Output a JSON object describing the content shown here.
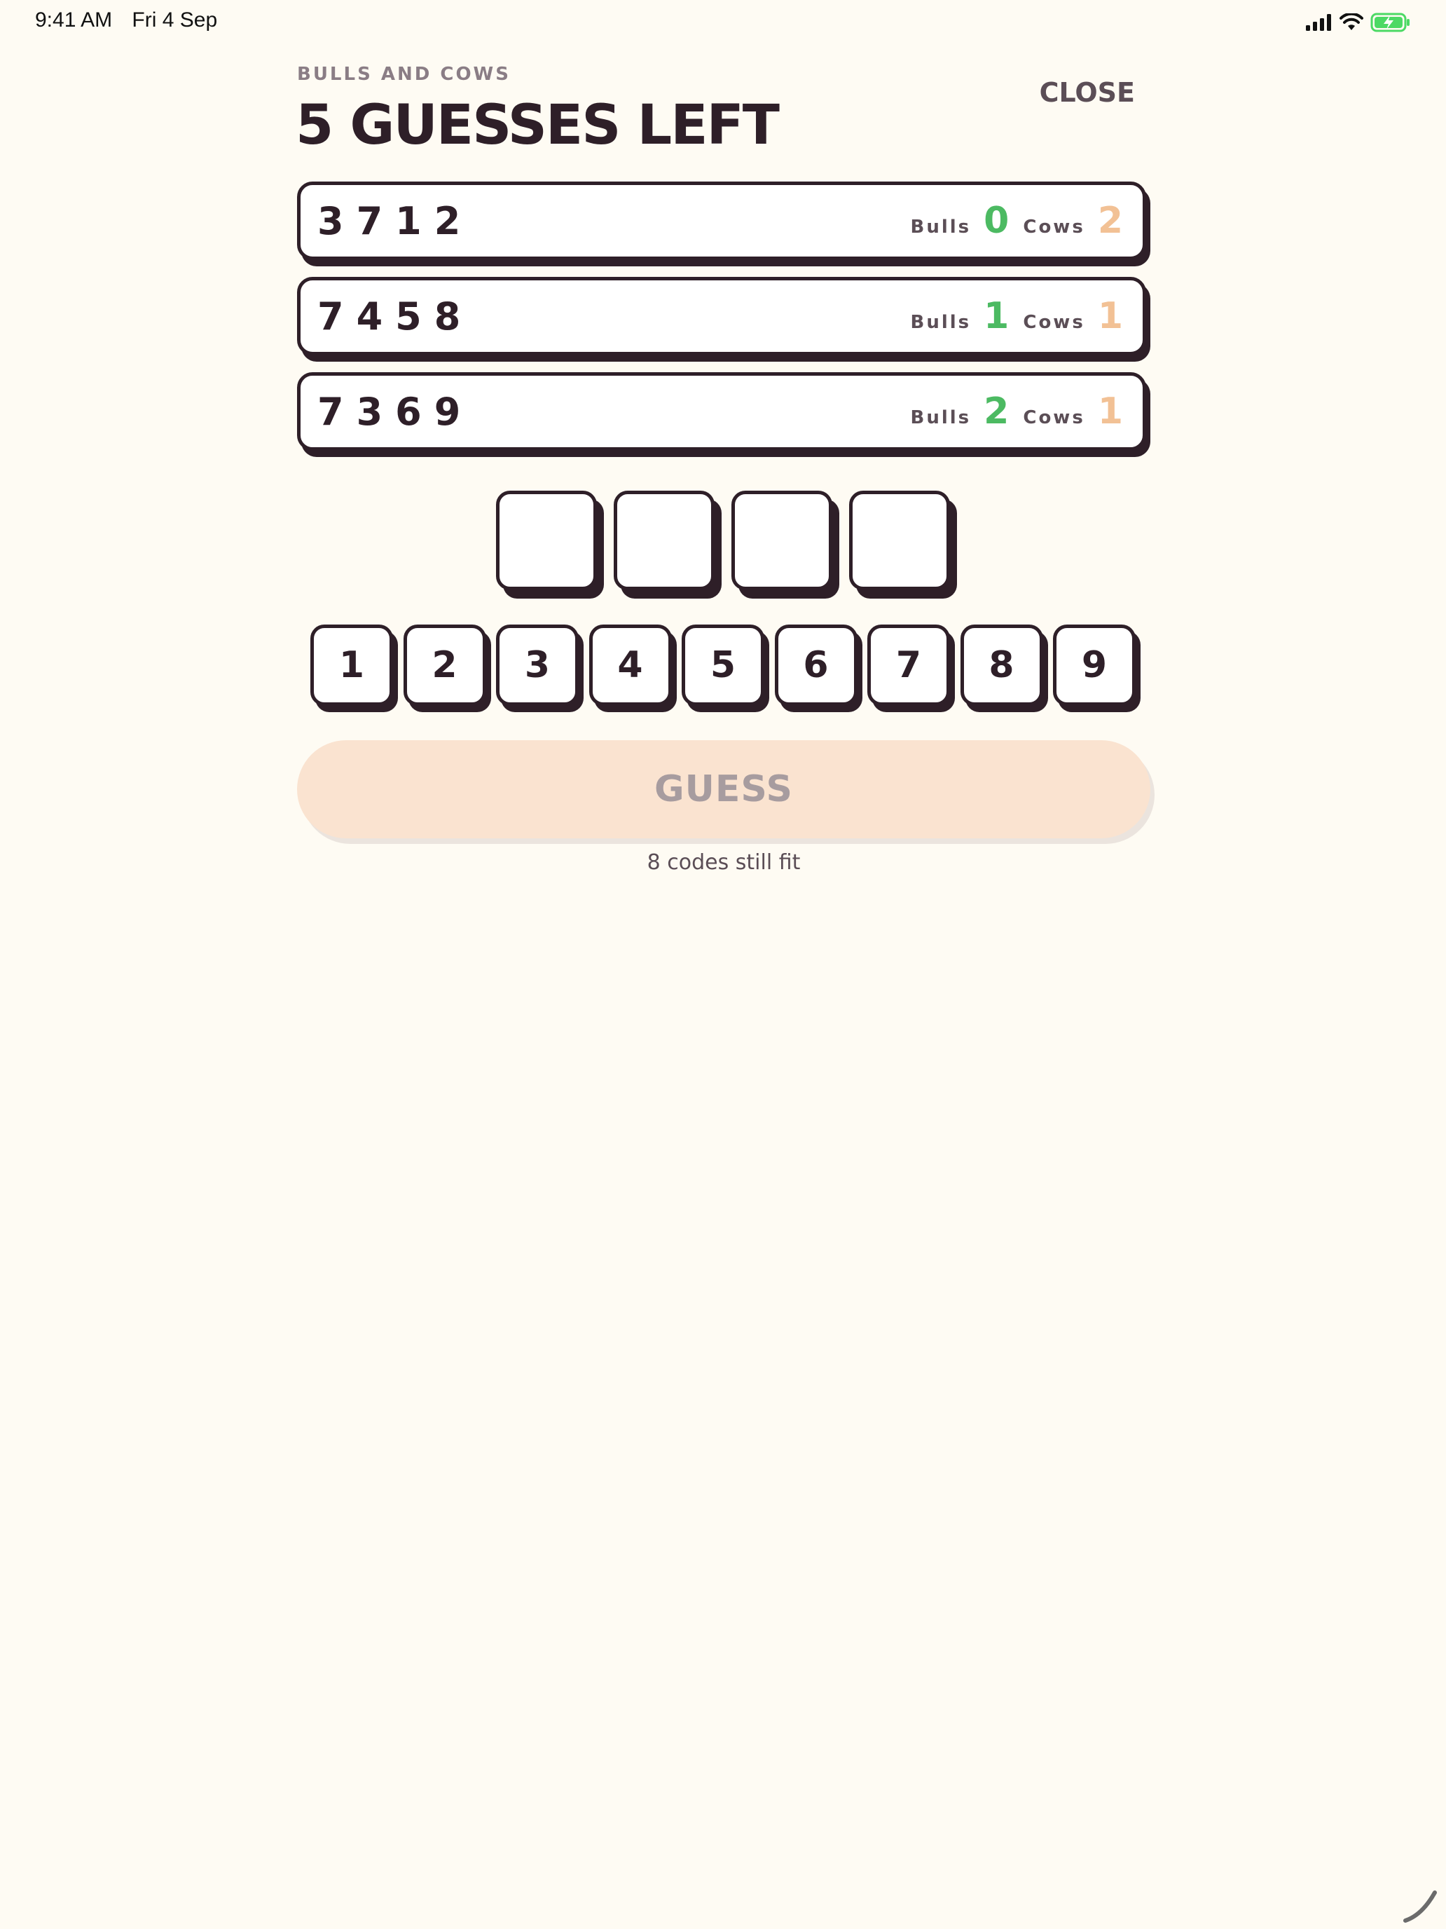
{
  "status_bar": {
    "time": "9:41 AM",
    "date": "Fri 4 Sep"
  },
  "header": {
    "subtitle": "BULLS AND COWS",
    "title": "5 GUESSES LEFT",
    "close_label": "CLOSE"
  },
  "guesses": [
    {
      "digits": "3712",
      "bulls_label": "Bulls",
      "bulls": "0",
      "cows_label": "Cows",
      "cows": "2"
    },
    {
      "digits": "7458",
      "bulls_label": "Bulls",
      "bulls": "1",
      "cows_label": "Cows",
      "cows": "1"
    },
    {
      "digits": "7369",
      "bulls_label": "Bulls",
      "bulls": "2",
      "cows_label": "Cows",
      "cows": "1"
    }
  ],
  "entry_slots": [
    "",
    "",
    "",
    ""
  ],
  "keypad": [
    "1",
    "2",
    "3",
    "4",
    "5",
    "6",
    "7",
    "8",
    "9"
  ],
  "guess_button_label": "GUESS",
  "hint": "8 codes still fit",
  "colors": {
    "background": "#fefbf3",
    "ink": "#2e1f28",
    "bulls": "#4cba62",
    "cows": "#f2c195",
    "guess_button_disabled": "#fae3d0",
    "battery": "#4cd964"
  },
  "icons": {
    "signal": "cellular-signal-icon",
    "wifi": "wifi-icon",
    "battery": "battery-charging-icon"
  }
}
